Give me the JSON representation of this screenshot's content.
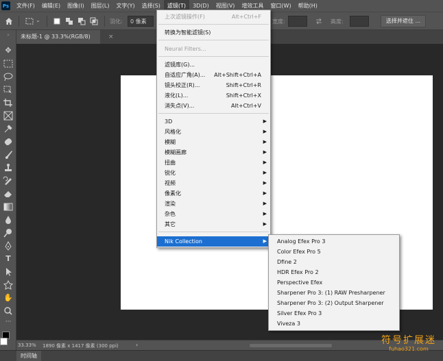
{
  "app": {
    "logo_text": "Ps"
  },
  "menubar": {
    "items": [
      {
        "label": "文件(F)"
      },
      {
        "label": "编辑(E)"
      },
      {
        "label": "图像(I)"
      },
      {
        "label": "图层(L)"
      },
      {
        "label": "文字(Y)"
      },
      {
        "label": "选择(S)"
      },
      {
        "label": "滤镜(T)"
      },
      {
        "label": "3D(D)"
      },
      {
        "label": "视图(V)"
      },
      {
        "label": "增效工具"
      },
      {
        "label": "窗口(W)"
      },
      {
        "label": "帮助(H)"
      }
    ],
    "active_index": 6
  },
  "options_bar": {
    "feather_label": "羽化:",
    "feather_value": "0 像素",
    "width_label": "宽度:",
    "height_label": "高度:",
    "select_mask_button": "选择并遮住 ..."
  },
  "document": {
    "tab_title": "未标题-1 @ 33.3%(RGB/8)",
    "tab_close": "×"
  },
  "status_bar": {
    "zoom": "33.33%",
    "info": "1890 像素 x 1417 像素 (300 ppi)",
    "arrow": "›"
  },
  "timeline_tab": "时间轴",
  "filter_menu": {
    "items": [
      {
        "label": "上次滤镜操作(F)",
        "shortcut": "Alt+Ctrl+F",
        "disabled": true
      },
      {
        "label": "转换为智能滤镜(S)",
        "shortcut": ""
      },
      {
        "label": "Neural Filters...",
        "shortcut": "",
        "disabled": true
      },
      {
        "label": "滤镜库(G)...",
        "shortcut": ""
      },
      {
        "label": "自适应广角(A)...",
        "shortcut": "Alt+Shift+Ctrl+A"
      },
      {
        "label": "镜头校正(R)...",
        "shortcut": "Shift+Ctrl+R"
      },
      {
        "label": "液化(L)...",
        "shortcut": "Shift+Ctrl+X"
      },
      {
        "label": "消失点(V)...",
        "shortcut": "Alt+Ctrl+V"
      },
      {
        "label": "3D",
        "submenu": true
      },
      {
        "label": "风格化",
        "submenu": true
      },
      {
        "label": "模糊",
        "submenu": true
      },
      {
        "label": "模糊画廊",
        "submenu": true
      },
      {
        "label": "扭曲",
        "submenu": true
      },
      {
        "label": "锐化",
        "submenu": true
      },
      {
        "label": "视频",
        "submenu": true
      },
      {
        "label": "像素化",
        "submenu": true
      },
      {
        "label": "渲染",
        "submenu": true
      },
      {
        "label": "杂色",
        "submenu": true
      },
      {
        "label": "其它",
        "submenu": true
      },
      {
        "label": "Nik Collection",
        "submenu": true,
        "highlighted": true
      }
    ],
    "submenu_arrow": "▶"
  },
  "nik_submenu": {
    "items": [
      {
        "label": "Analog Efex Pro 3"
      },
      {
        "label": "Color Efex Pro 5"
      },
      {
        "label": "Dfine 2"
      },
      {
        "label": "HDR Efex Pro 2"
      },
      {
        "label": "Perspective Efex"
      },
      {
        "label": "Sharpener Pro 3: (1) RAW Presharpener"
      },
      {
        "label": "Sharpener Pro 3: (2) Output Sharpener"
      },
      {
        "label": "Silver Efex Pro 3"
      },
      {
        "label": "Viveza 3"
      }
    ]
  },
  "watermark": {
    "cn": "符号扩展迷",
    "url": "fuhao321.com"
  },
  "colors": {
    "highlight": "#1c6fd0",
    "panel": "#535353",
    "pasteboard": "#282828",
    "watermark": "#f0a21a"
  }
}
